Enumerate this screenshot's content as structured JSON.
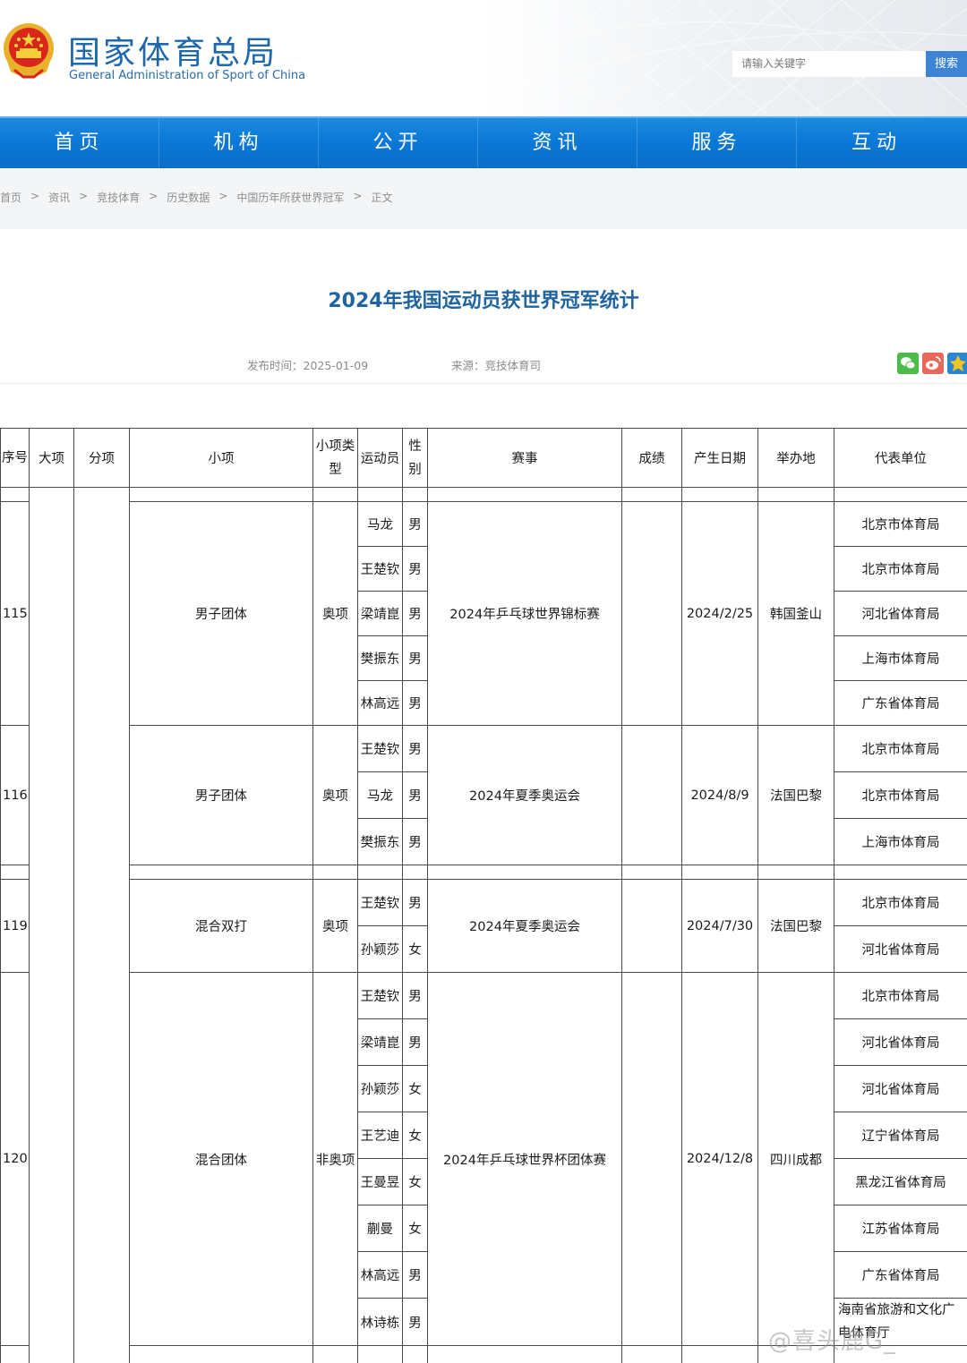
{
  "header": {
    "logo_cn": "国家体育总局",
    "logo_en": "General Administration of Sport of China",
    "search_placeholder": "请输入关键字",
    "search_button": "搜索"
  },
  "nav": [
    "首页",
    "机构",
    "公开",
    "资讯",
    "服务",
    "互动"
  ],
  "breadcrumb": [
    "首页",
    "资讯",
    "竞技体育",
    "历史数据",
    "中国历年所获世界冠军",
    "正文"
  ],
  "breadcrumb_separator": ">",
  "article": {
    "title": "2024年我国运动员获世界冠军统计",
    "publish_label": "发布时间：",
    "publish_date": "2025-01-09",
    "source_label": "来源：",
    "source": "竞技体育司"
  },
  "share_icons": [
    "wechat-icon",
    "weibo-icon",
    "qzone-icon"
  ],
  "table": {
    "headers": {
      "seq": "序号",
      "big": "大项",
      "sub": "分项",
      "item": "小项",
      "type": "小项类型",
      "athlete": "运动员",
      "sex": "性别",
      "event": "赛事",
      "result": "成绩",
      "date": "产生日期",
      "location": "举办地",
      "unit": "代表单位"
    },
    "groups": [
      {
        "seq": "115",
        "item": "男子团体",
        "type": "奥项",
        "event": "2024年乒乓球世界锦标赛",
        "result": "",
        "date": "2024/2/25",
        "location": "韩国釜山",
        "members": [
          {
            "name": "马龙",
            "sex": "男",
            "unit": "北京市体育局"
          },
          {
            "name": "王楚钦",
            "sex": "男",
            "unit": "北京市体育局"
          },
          {
            "name": "梁靖崑",
            "sex": "男",
            "unit": "河北省体育局"
          },
          {
            "name": "樊振东",
            "sex": "男",
            "unit": "上海市体育局"
          },
          {
            "name": "林高远",
            "sex": "男",
            "unit": "广东省体育局"
          }
        ]
      },
      {
        "seq": "116",
        "item": "男子团体",
        "type": "奥项",
        "event": "2024年夏季奥运会",
        "result": "",
        "date": "2024/8/9",
        "location": "法国巴黎",
        "members": [
          {
            "name": "王楚钦",
            "sex": "男",
            "unit": "北京市体育局"
          },
          {
            "name": "马龙",
            "sex": "男",
            "unit": "北京市体育局"
          },
          {
            "name": "樊振东",
            "sex": "男",
            "unit": "上海市体育局"
          }
        ]
      },
      {
        "seq": "119",
        "item": "混合双打",
        "type": "奥项",
        "event": "2024年夏季奥运会",
        "result": "",
        "date": "2024/7/30",
        "location": "法国巴黎",
        "members": [
          {
            "name": "王楚钦",
            "sex": "男",
            "unit": "北京市体育局"
          },
          {
            "name": "孙颖莎",
            "sex": "女",
            "unit": "河北省体育局"
          }
        ]
      },
      {
        "seq": "120",
        "item": "混合团体",
        "type": "非奥项",
        "event": "2024年乒乓球世界杯团体赛",
        "result": "",
        "date": "2024/12/8",
        "location": "四川成都",
        "members": [
          {
            "name": "王楚钦",
            "sex": "男",
            "unit": "北京市体育局"
          },
          {
            "name": "梁靖崑",
            "sex": "男",
            "unit": "河北省体育局"
          },
          {
            "name": "孙颖莎",
            "sex": "女",
            "unit": "河北省体育局"
          },
          {
            "name": "王艺迪",
            "sex": "女",
            "unit": "辽宁省体育局"
          },
          {
            "name": "王曼昱",
            "sex": "女",
            "unit": "黑龙江省体育局"
          },
          {
            "name": "蒯曼",
            "sex": "女",
            "unit": "江苏省体育局"
          },
          {
            "name": "林高远",
            "sex": "男",
            "unit": "广东省体育局"
          },
          {
            "name": "林诗栋",
            "sex": "男",
            "unit": "海南省旅游和文化广电体育厅"
          }
        ]
      }
    ]
  },
  "watermark": "@喜头鹿G_"
}
